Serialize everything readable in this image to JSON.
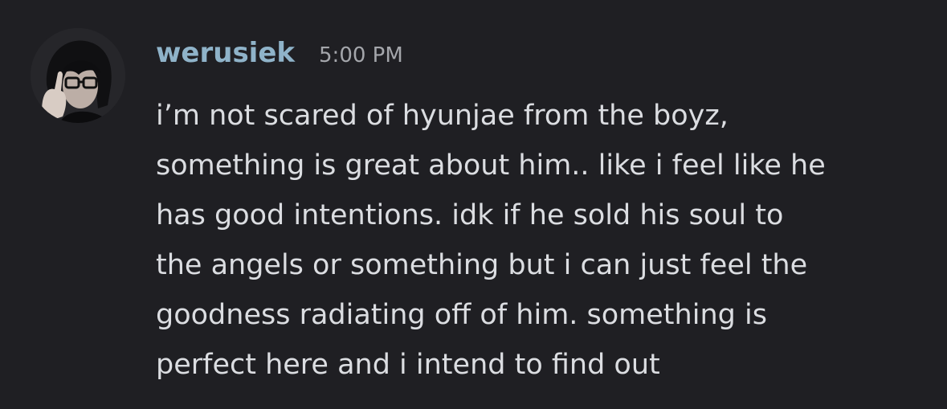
{
  "message": {
    "author": "werusiek",
    "timestamp": "5:00 PM",
    "avatar_icon": "user-avatar",
    "colors": {
      "background": "#1f1f23",
      "author": "#8fb3c9",
      "timestamp": "#a4a6ab",
      "text": "#dbdde1"
    },
    "lines": [
      "i’m not scared of hyunjae from the boyz,",
      "something is great about him.. like i feel like he",
      "has good intentions. idk if he sold his soul to",
      "the angels or something but i can just feel the",
      "goodness radiating off of him. something is",
      "perfect here and i intend to find out"
    ]
  }
}
